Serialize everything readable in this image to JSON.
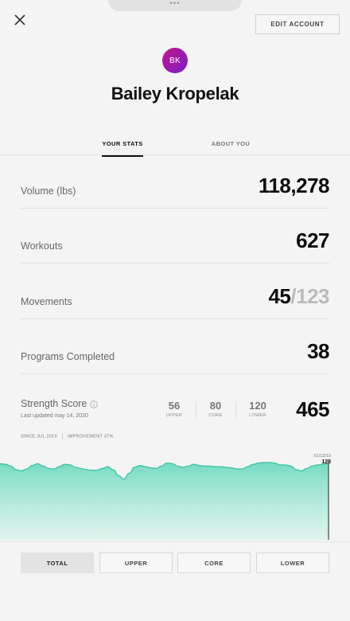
{
  "handle": {
    "dots": "•••"
  },
  "header": {
    "edit_label": "EDIT ACCOUNT"
  },
  "profile": {
    "initials": "BK",
    "name": "Bailey Kropelak"
  },
  "tabs": [
    {
      "label": "YOUR STATS",
      "active": true
    },
    {
      "label": "ABOUT YOU",
      "active": false
    }
  ],
  "stats": [
    {
      "label": "Volume (lbs)",
      "value": "118,278"
    },
    {
      "label": "Workouts",
      "value": "627"
    },
    {
      "label": "Movements",
      "value": "45",
      "total": "/123"
    },
    {
      "label": "Programs Completed",
      "value": "38"
    }
  ],
  "strength": {
    "title": "Strength Score",
    "updated": "Last updated may 14, 2020",
    "subscores": [
      {
        "value": "56",
        "label": "UPPER"
      },
      {
        "value": "80",
        "label": "CORE"
      },
      {
        "value": "120",
        "label": "LOWER"
      }
    ],
    "total": "465",
    "since": "SINCE JUL 2019",
    "improvement": "IMPROVEMENT 37%"
  },
  "chart_data": {
    "type": "area",
    "latest_date": "01/12/19",
    "latest_value": "128",
    "values": [
      128,
      127,
      124,
      118,
      116,
      119,
      125,
      128,
      124,
      120,
      119,
      123,
      127,
      126,
      122,
      120,
      118,
      117,
      117,
      120,
      123,
      118,
      108,
      102,
      112,
      122,
      125,
      123,
      121,
      120,
      124,
      129,
      128,
      124,
      122,
      124,
      127,
      125,
      124,
      124,
      123,
      123,
      122,
      121,
      119,
      119,
      123,
      127,
      129,
      130,
      130,
      129,
      126,
      126,
      124,
      118,
      116,
      120,
      124,
      126,
      127,
      128
    ],
    "ylim": [
      0,
      150
    ],
    "color": "#5fd3b8"
  },
  "filters": [
    {
      "label": "TOTAL",
      "selected": true
    },
    {
      "label": "UPPER",
      "selected": false
    },
    {
      "label": "CORE",
      "selected": false
    },
    {
      "label": "LOWER",
      "selected": false
    }
  ]
}
